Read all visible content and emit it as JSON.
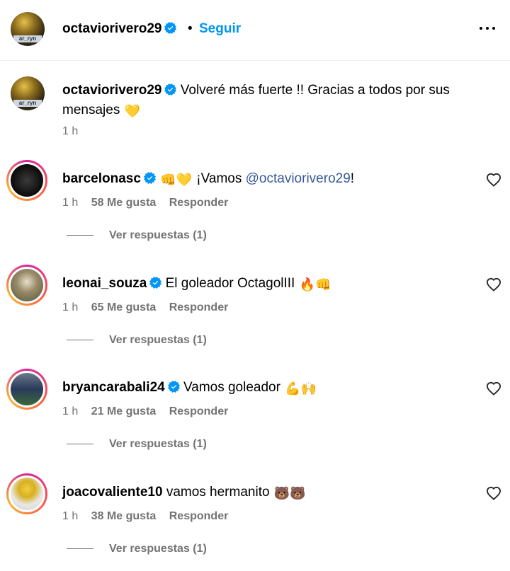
{
  "header": {
    "username": "octaviorivero29",
    "separator": "•",
    "follow_label": "Seguir",
    "avatar_tag": "ar_ryn"
  },
  "caption": {
    "username": "octaviorivero29",
    "text": "Volveré más fuerte !! Gracias a todos por sus mensajes",
    "emoji": "💛",
    "time": "1 h"
  },
  "comments": [
    {
      "username": "barcelonasc",
      "verified": true,
      "prefix_emoji": "👊💛",
      "text_before": "¡Vamos ",
      "mention": "@octaviorivero29",
      "text_after": "!",
      "time": "1 h",
      "likes": "58 Me gusta",
      "reply_label": "Responder",
      "replies_label": "Ver respuestas (1)"
    },
    {
      "username": "leonai_souza",
      "verified": true,
      "text": "El goleador OctagolIII",
      "suffix_emoji": "🔥👊",
      "time": "1 h",
      "likes": "65 Me gusta",
      "reply_label": "Responder",
      "replies_label": "Ver respuestas (1)"
    },
    {
      "username": "bryancarabali24",
      "verified": true,
      "text": "Vamos goleador",
      "suffix_emoji": "💪🙌",
      "time": "1 h",
      "likes": "21 Me gusta",
      "reply_label": "Responder",
      "replies_label": "Ver respuestas (1)"
    },
    {
      "username": "joacovaliente10",
      "verified": false,
      "text": "vamos hermanito",
      "suffix_emoji": "🐻🐻",
      "time": "1 h",
      "likes": "38 Me gusta",
      "reply_label": "Responder",
      "replies_label": "Ver respuestas (1)"
    }
  ],
  "colors": {
    "accent": "#0095f6",
    "verified": "#0095f6",
    "muted": "#737373",
    "mention": "#385898"
  },
  "icons": {
    "more": "more-options-icon",
    "verified": "verified-badge-icon",
    "like": "heart-icon"
  }
}
